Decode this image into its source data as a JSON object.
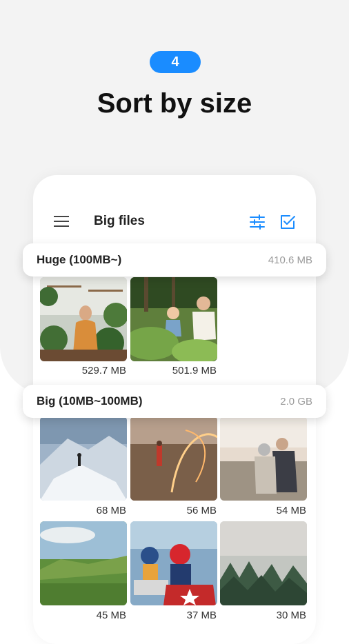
{
  "hero": {
    "step": "4",
    "title": "Sort by size"
  },
  "toolbar": {
    "title": "Big files",
    "menu_icon": "menu-icon",
    "filter_icon": "filter-sliders-icon",
    "select_icon": "checkbox-icon"
  },
  "colors": {
    "accent": "#1a8cff",
    "background": "#f3f3f3",
    "muted_text": "#9a9a9a"
  },
  "sections": [
    {
      "title": "Huge (100MB~)",
      "total": "410.6 MB",
      "files": [
        {
          "size": "529.7 MB"
        },
        {
          "size": "501.9 MB"
        }
      ]
    },
    {
      "title": "Big (10MB~100MB)",
      "total": "2.0 GB",
      "files": [
        {
          "size": "68 MB"
        },
        {
          "size": "56 MB"
        },
        {
          "size": "54 MB"
        },
        {
          "size": "45 MB"
        },
        {
          "size": "37 MB"
        },
        {
          "size": "30 MB"
        }
      ]
    }
  ]
}
